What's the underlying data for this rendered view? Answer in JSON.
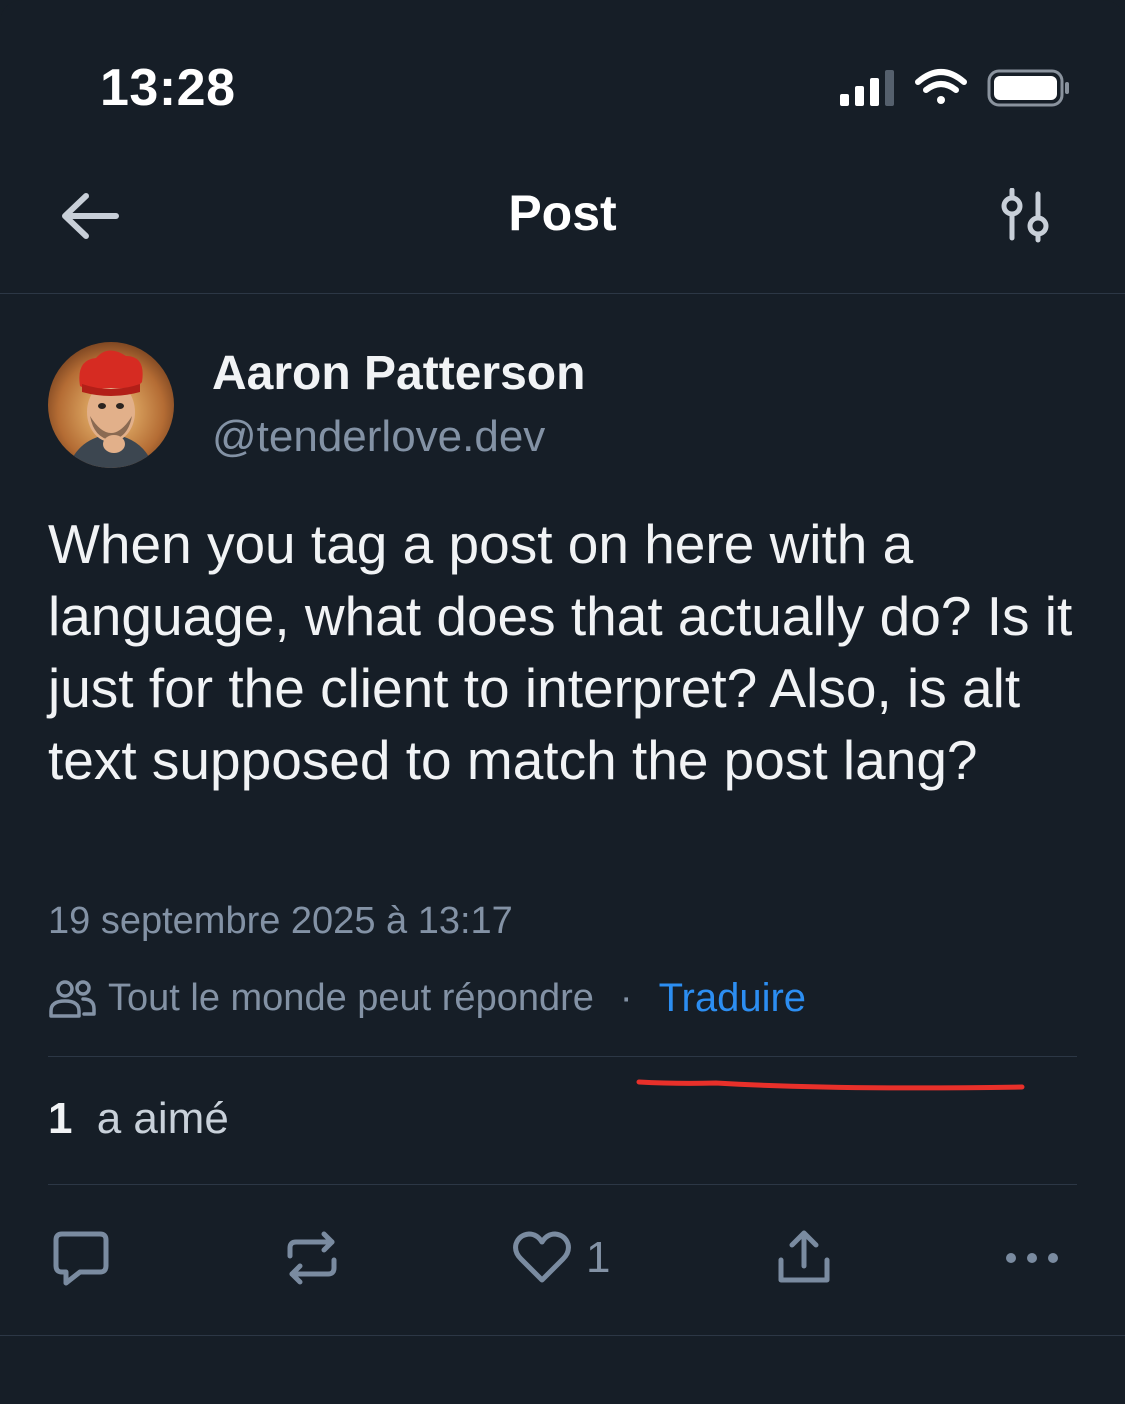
{
  "status_bar": {
    "time": "13:28",
    "icons": [
      "signal-icon",
      "wifi-icon",
      "battery-icon"
    ]
  },
  "header": {
    "back_icon": "arrow-left-icon",
    "title": "Post",
    "filter_icon": "sliders-icon"
  },
  "post": {
    "author": {
      "name": "Aaron Patterson",
      "handle": "@tenderlove.dev"
    },
    "text": "When you tag a post on here with a language, what does that actually do? Is it just for the client to interpret? Also, is alt text supposed to match the post lang?",
    "date": "19 septembre 2025 à 13:17",
    "reply_setting": "Tout le monde peut répondre",
    "separator": "·",
    "translate_label": "Traduire",
    "likes": {
      "count": "1",
      "label": "a aimé"
    },
    "actions": {
      "reply_icon": "comment-icon",
      "repost_icon": "repost-icon",
      "like_icon": "heart-icon",
      "like_count": "1",
      "share_icon": "share-icon",
      "more_icon": "more-icon"
    }
  },
  "colors": {
    "background": "#161e27",
    "text": "#f1f3f5",
    "muted": "#8392a5",
    "link": "#2c8ef2",
    "annotation": "#e8302a"
  }
}
